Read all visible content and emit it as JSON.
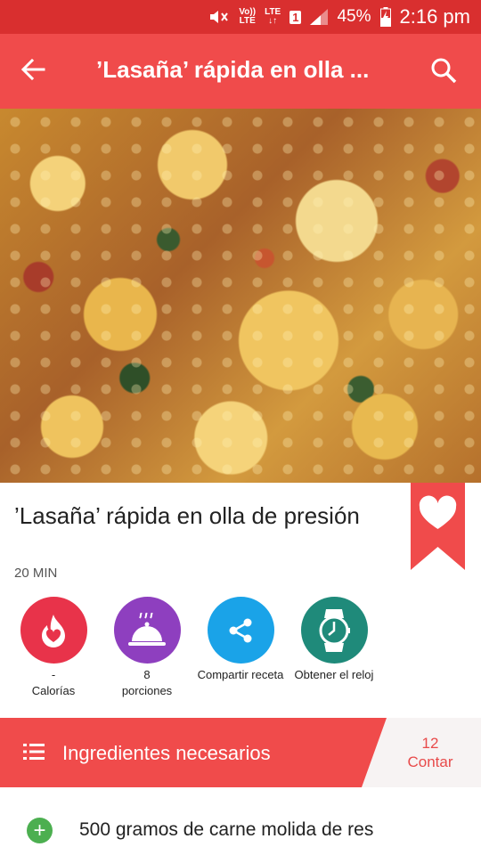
{
  "status_bar": {
    "volte_top": "Vo))",
    "volte_bottom": "LTE",
    "lte_top": "LTE",
    "lte_bottom": "↓↑",
    "sim": "1",
    "battery": "45%",
    "time": "2:16 pm"
  },
  "app_bar": {
    "title": "’Lasaña’ rápida en olla ..."
  },
  "recipe": {
    "title": "’Lasaña’ rápida en olla de presión",
    "time": "20 MIN"
  },
  "actions": [
    {
      "value": "-",
      "label": "Calorías",
      "color": "#e8334a",
      "icon": "flame-heart-icon"
    },
    {
      "value": "8",
      "label": "porciones",
      "color": "#8e3fbf",
      "icon": "cloche-icon"
    },
    {
      "value": "",
      "label": "Compartir receta",
      "color": "#1aa3e8",
      "icon": "share-icon"
    },
    {
      "value": "",
      "label": "Obtener el reloj",
      "color": "#1f8a7a",
      "icon": "watch-icon"
    }
  ],
  "ingredients_header": {
    "title": "Ingredientes necesarios",
    "count": "12",
    "count_label": "Contar"
  },
  "ingredients": [
    {
      "text": "500 gramos de carne molida de res"
    }
  ],
  "colors": {
    "status_bar": "#d92f2f",
    "app_bar": "#f04b4b",
    "accent": "#e84a4a",
    "add_button": "#4caf50"
  }
}
